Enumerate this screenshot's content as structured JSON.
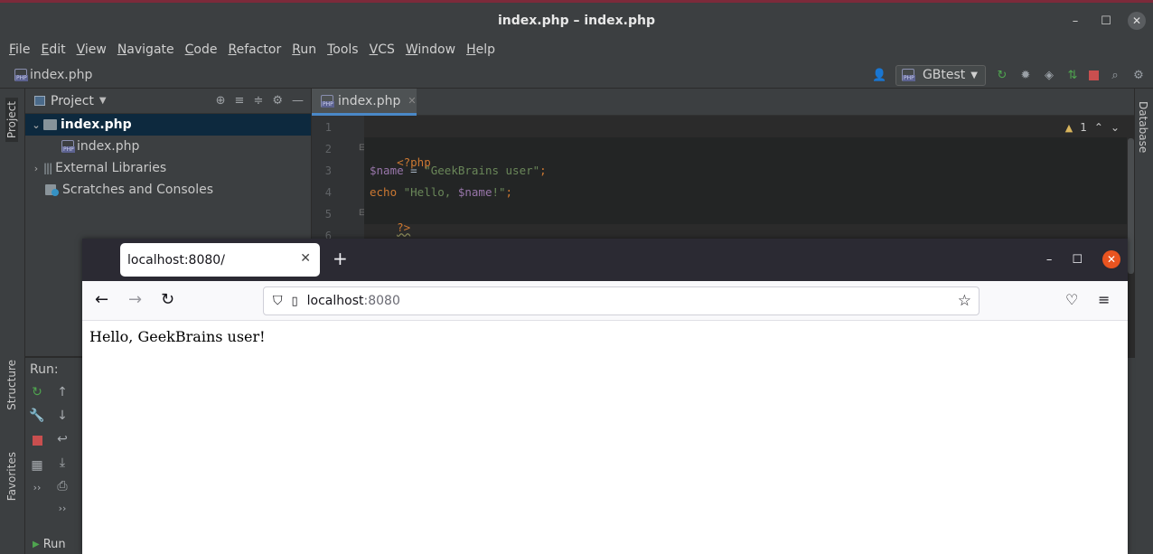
{
  "ide": {
    "title": "index.php – index.php",
    "menu": [
      "File",
      "Edit",
      "View",
      "Navigate",
      "Code",
      "Refactor",
      "Run",
      "Tools",
      "VCS",
      "Window",
      "Help"
    ],
    "nav_file": "index.php",
    "run_config": "GBtest",
    "left_tabs": {
      "project": "Project",
      "structure": "Structure",
      "favorites": "Favorites"
    },
    "right_tab": "Database",
    "project_panel": {
      "title": "Project",
      "tree": [
        {
          "label": "index.php",
          "type": "folder",
          "selected": true
        },
        {
          "label": "index.php",
          "type": "php-file",
          "selected": false
        },
        {
          "label": "External Libraries",
          "type": "libraries",
          "selected": false
        },
        {
          "label": "Scratches and Consoles",
          "type": "scratches",
          "selected": false
        }
      ]
    },
    "editor": {
      "tab_label": "index.php",
      "inspection_count": "1",
      "line_numbers": [
        "1",
        "2",
        "3",
        "4",
        "5",
        "6"
      ],
      "code": {
        "l2_open": "<?php",
        "l3_var": "$name",
        "l3_op": " = ",
        "l3_str": "\"GeekBrains user\"",
        "l3_end": ";",
        "l4_kw": "echo",
        "l4_str_a": " \"Hello, ",
        "l4_var": "$name",
        "l4_str_b": "!\"",
        "l4_end": ";",
        "l5_close": "?>"
      }
    },
    "run_panel": {
      "label": "Run:",
      "bottom_label": "Run"
    }
  },
  "browser": {
    "tab_title": "localhost:8080/",
    "url_host": "localhost",
    "url_port": ":8080",
    "page_text": "Hello, GeekBrains user!"
  },
  "colors": {
    "ide_bg": "#2b2b2b",
    "ide_panel": "#3c3f41",
    "selection": "#0d293e",
    "keyword": "#cc7832",
    "variable": "#9876aa",
    "string": "#6a8759",
    "browser_close": "#e95420"
  }
}
